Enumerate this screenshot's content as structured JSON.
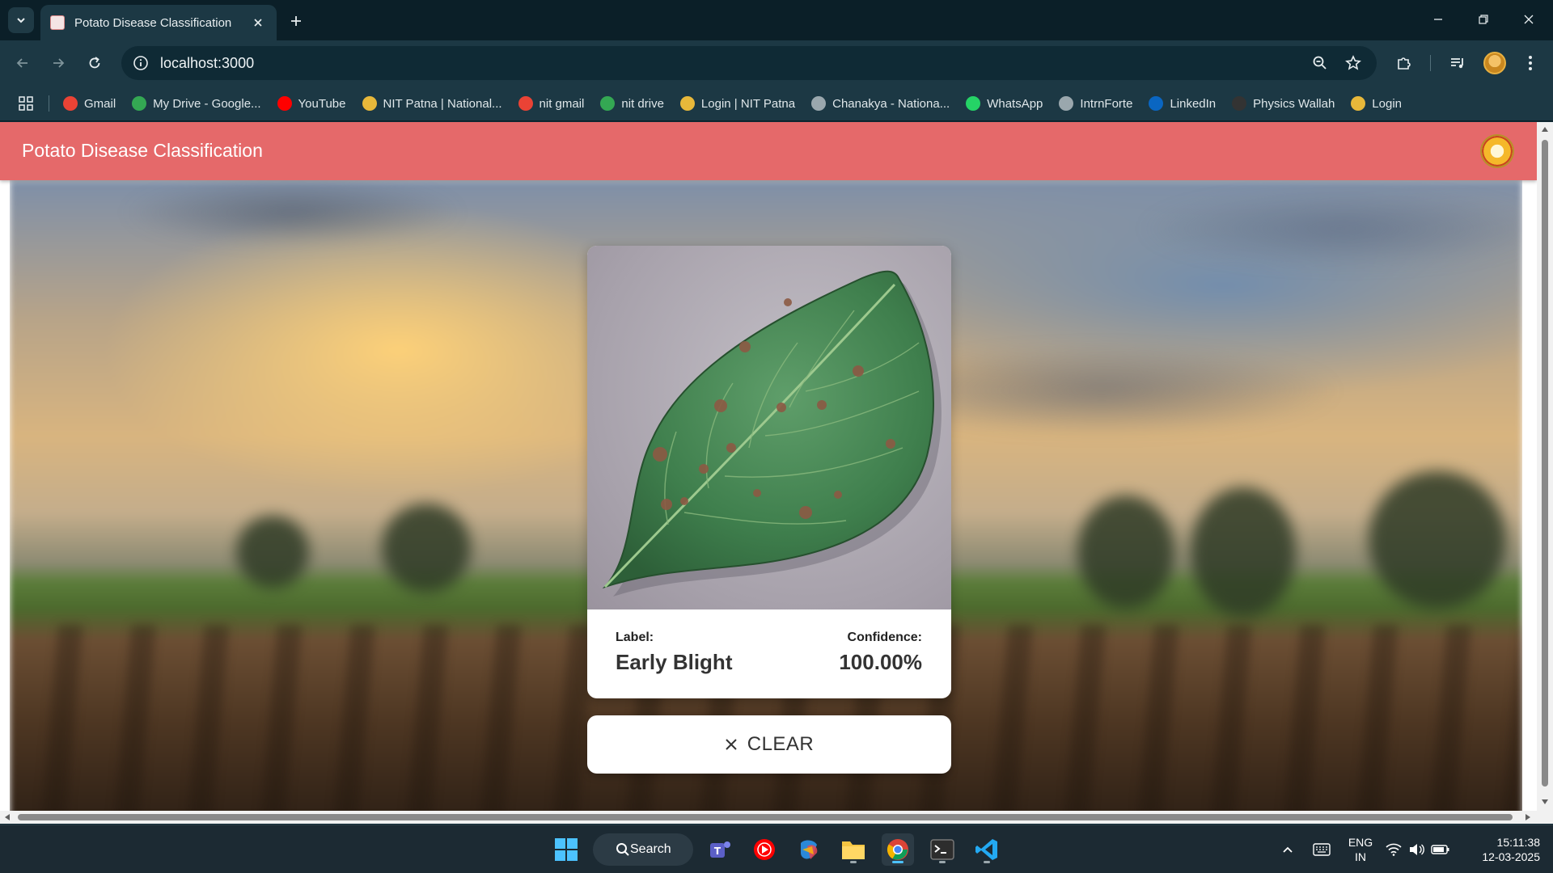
{
  "browser": {
    "tab_title": "Potato Disease Classification",
    "url": "localhost:3000",
    "bookmarks": [
      {
        "label": "Gmail",
        "icon": "gmail-icon",
        "color": "#ea4335"
      },
      {
        "label": "My Drive - Google...",
        "icon": "google-drive-icon",
        "color": "#34a853"
      },
      {
        "label": "YouTube",
        "icon": "youtube-icon",
        "color": "#ff0000"
      },
      {
        "label": "NIT Patna | National...",
        "icon": "nit-patna-icon",
        "color": "#e8b83a"
      },
      {
        "label": "nit gmail",
        "icon": "gmail-icon",
        "color": "#ea4335"
      },
      {
        "label": "nit drive",
        "icon": "google-drive-icon",
        "color": "#34a853"
      },
      {
        "label": "Login | NIT Patna",
        "icon": "nit-patna-icon",
        "color": "#e8b83a"
      },
      {
        "label": "Chanakya - Nationa...",
        "icon": "globe-icon",
        "color": "#9aa7ad"
      },
      {
        "label": "WhatsApp",
        "icon": "whatsapp-icon",
        "color": "#25d366"
      },
      {
        "label": "IntrnForte",
        "icon": "globe-icon",
        "color": "#9aa7ad"
      },
      {
        "label": "LinkedIn",
        "icon": "linkedin-icon",
        "color": "#0a66c2"
      },
      {
        "label": "Physics Wallah",
        "icon": "physics-wallah-icon",
        "color": "#333333"
      },
      {
        "label": "Login",
        "icon": "nit-patna-icon",
        "color": "#e8b83a"
      }
    ]
  },
  "app": {
    "title": "Potato Disease Classification",
    "header_color": "#e5696a",
    "result": {
      "label_caption": "Label:",
      "label_value": "Early Blight",
      "confidence_caption": "Confidence:",
      "confidence_value": "100.00%"
    },
    "clear_button": "CLEAR"
  },
  "taskbar": {
    "search_label": "Search",
    "language": "ENG",
    "region": "IN",
    "time": "15:11:38",
    "date": "12-03-2025"
  }
}
